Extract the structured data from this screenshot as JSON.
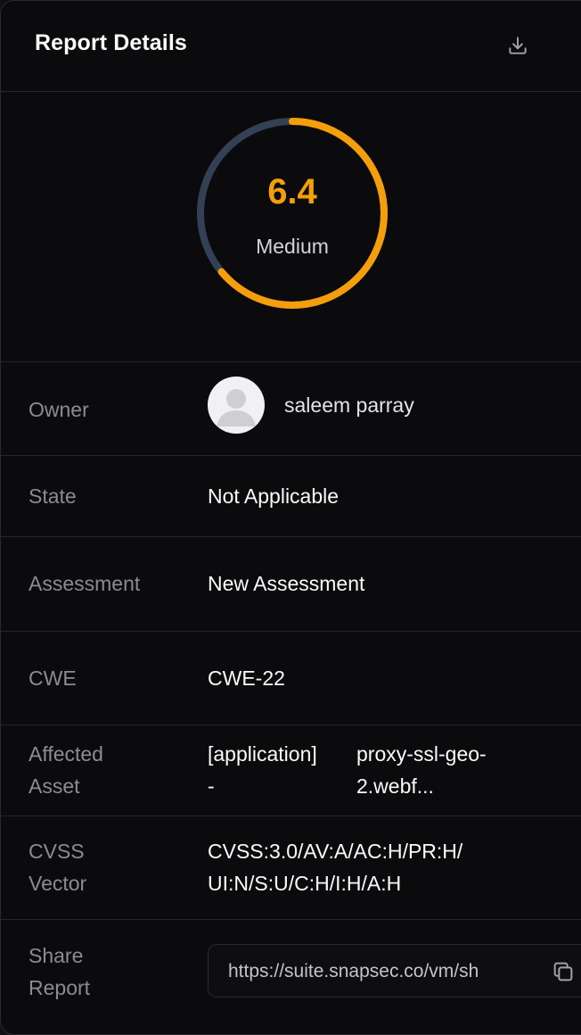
{
  "header": {
    "title": "Report Details",
    "download_icon": "download-icon"
  },
  "score": {
    "value": "6.4",
    "severity": "Medium",
    "fraction": 0.64,
    "arc_color": "#f59e0b",
    "track_color": "#334155"
  },
  "details": {
    "owner": {
      "label": "Owner",
      "name": "saleem parray",
      "avatar_icon": "user-avatar-icon"
    },
    "state": {
      "label": "State",
      "value": "Not Applicable"
    },
    "assessment": {
      "label": "Assessment",
      "value": "New Assessment"
    },
    "cwe": {
      "label": "CWE",
      "value": "CWE-22"
    },
    "affected_asset": {
      "label_line1": "Affected",
      "label_line2": "Asset",
      "type_line1": "[application]",
      "type_line2": "-",
      "host_line1": "proxy-ssl-geo-",
      "host_line2": "2.webf..."
    },
    "cvss_vector": {
      "label_line1": "CVSS",
      "label_line2": "Vector",
      "value_line1": "CVSS:3.0/AV:A/AC:H/PR:H/",
      "value_line2": "UI:N/S:U/C:H/I:H/A:H"
    },
    "share_report": {
      "label_line1": "Share",
      "label_line2": "Report",
      "url": "https://suite.snapsec.co/vm/sh",
      "copy_icon": "copy-icon"
    }
  }
}
